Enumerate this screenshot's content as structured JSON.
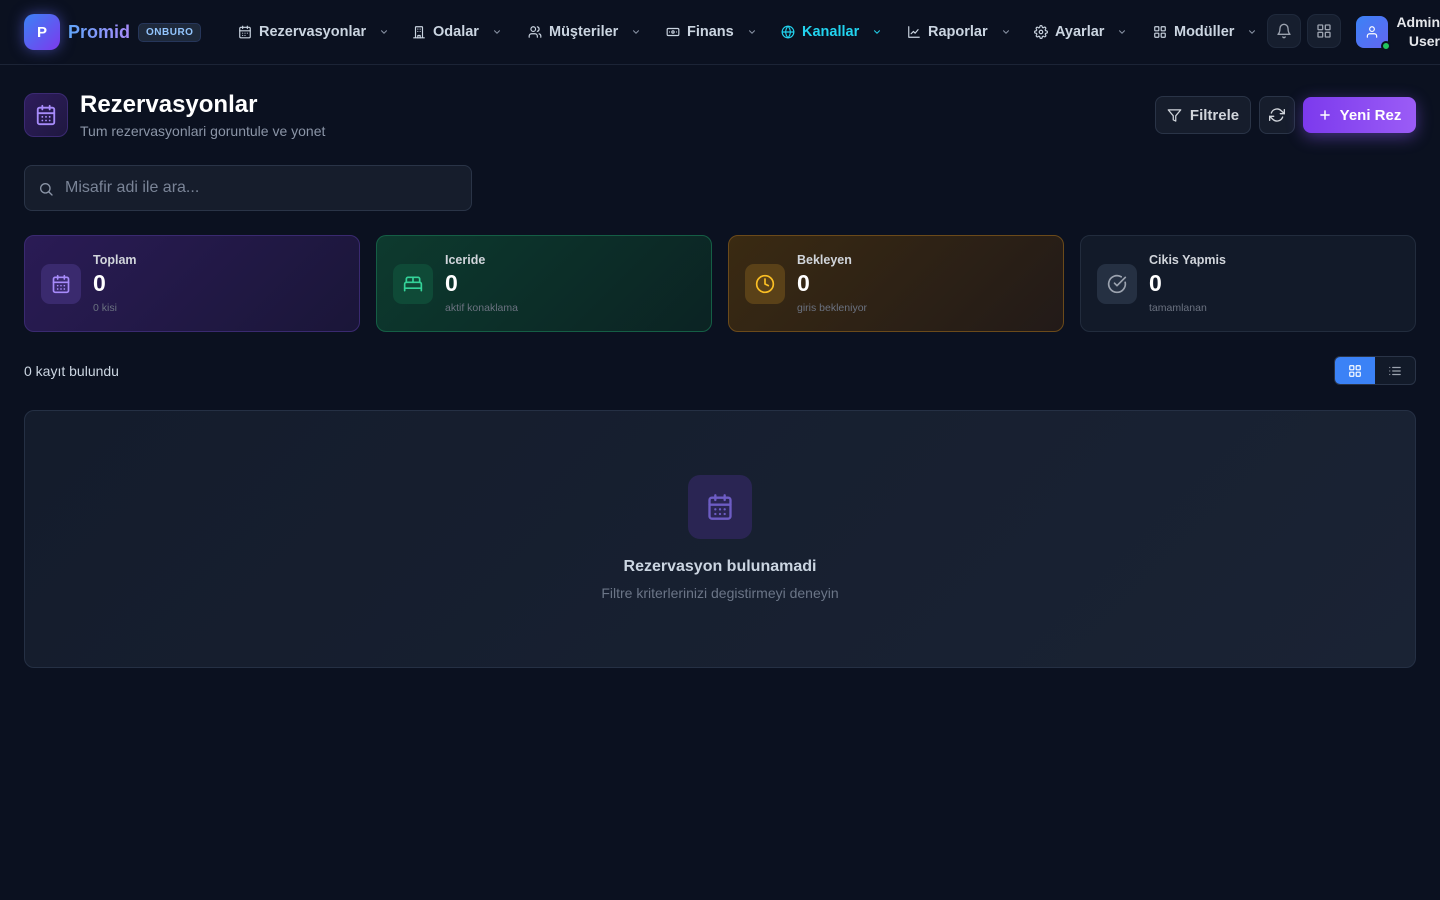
{
  "brand": {
    "logo_letter": "P",
    "name": "Promid",
    "badge": "ONBURO"
  },
  "nav": [
    {
      "label": "Rezervasyonlar",
      "icon": "calendar-icon"
    },
    {
      "label": "Odalar",
      "icon": "building-icon"
    },
    {
      "label": "Müşteriler",
      "icon": "users-icon"
    },
    {
      "label": "Finans",
      "icon": "money-icon"
    },
    {
      "label": "Kanallar",
      "icon": "globe-icon",
      "active": true
    },
    {
      "label": "Raporlar",
      "icon": "chart-icon"
    },
    {
      "label": "Ayarlar",
      "icon": "gear-icon"
    },
    {
      "label": "Modüller",
      "icon": "grid-icon"
    }
  ],
  "user": {
    "line1": "Admin",
    "line2": "User"
  },
  "page": {
    "title": "Rezervasyonlar",
    "subtitle": "Tum rezervasyonlari goruntule ve yonet",
    "filter_label": "Filtrele",
    "new_label": "Yeni Rez"
  },
  "search": {
    "placeholder": "Misafir adi ile ara...",
    "value": ""
  },
  "stats": [
    {
      "label": "Toplam",
      "value": "0",
      "sub": "0 kisi",
      "icon": "calendar-icon",
      "color": "#a78bfa"
    },
    {
      "label": "Iceride",
      "value": "0",
      "sub": "aktif konaklama",
      "icon": "bed-icon",
      "color": "#34d399"
    },
    {
      "label": "Bekleyen",
      "value": "0",
      "sub": "giris bekleniyor",
      "icon": "clock-icon",
      "color": "#fbbf24"
    },
    {
      "label": "Cikis Yapmis",
      "value": "0",
      "sub": "tamamlanan",
      "icon": "check-circle-icon",
      "color": "#9ca3af"
    }
  ],
  "results": {
    "count_text": "0 kayıt bulundu",
    "view_mode": "grid"
  },
  "empty": {
    "title": "Rezervasyon bulunamadi",
    "subtitle": "Filtre kriterlerinizi degistirmeyi deneyin"
  },
  "colors": {
    "background": "#0b1120",
    "accent_purple": "#8b5cf6",
    "accent_blue": "#3b82f6",
    "nav_active": "#22d3ee",
    "online_status": "#22c55e"
  }
}
